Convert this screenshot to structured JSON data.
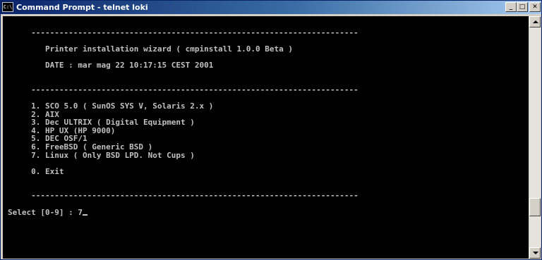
{
  "window": {
    "title": "Command Prompt - telnet loki",
    "icon": "cmd-icon",
    "icon_text": "C:\\",
    "controls": {
      "minimize": "_",
      "maximize": "□",
      "close": "✕"
    }
  },
  "terminal": {
    "lines": [
      "",
      "     ----------------------------------------------------------------------",
      "",
      "        Printer installation wizard ( cmpinstall 1.0.0 Beta )",
      "",
      "        DATE : mar mag 22 10:17:15 CEST 2001",
      "",
      "",
      "     ----------------------------------------------------------------------",
      "",
      "     1. SCO 5.0 ( SunOS SYS V, Solaris 2.x )",
      "     2. AIX",
      "     3. Dec ULTRIX ( Digital Equipment )",
      "     4. HP UX (HP 9000)",
      "     5. DEC OSF/1",
      "     6. FreeBSD ( Generic BSD )",
      "     7. Linux ( Only BSD LPD. Not Cups )",
      "",
      "     0. Exit",
      "",
      "",
      "     ----------------------------------------------------------------------",
      "",
      "Select [0-9] : 7"
    ]
  },
  "colors": {
    "console_bg": "#000000",
    "console_fg": "#c0c0c0",
    "titlebar_start": "#0a246a",
    "titlebar_end": "#a6caf0"
  }
}
